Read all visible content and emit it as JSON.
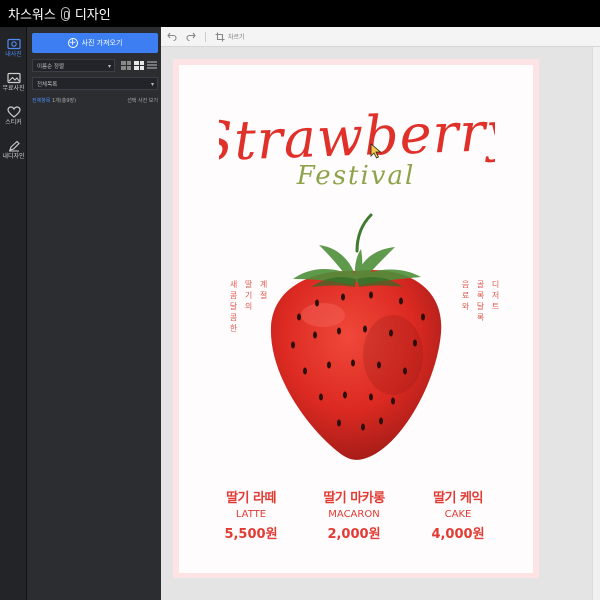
{
  "app": {
    "title_left": "차스워스",
    "title_right": "디자인"
  },
  "rail": [
    {
      "label": "내사진",
      "icon": "photo-icon"
    },
    {
      "label": "무료사진",
      "icon": "free-photo-icon"
    },
    {
      "label": "스티커",
      "icon": "heart-icon"
    },
    {
      "label": "내디자인",
      "icon": "pencil-icon"
    }
  ],
  "panel": {
    "load_button": "사진 가져오기",
    "sort_select": "이름순 정렬",
    "folder_select": "전체목록",
    "info_prefix": "전체항목",
    "info_count": "1개(총9장)",
    "info_action": "선택 사진 보기"
  },
  "toolbar": {
    "crop_label": "자르기"
  },
  "poster": {
    "title": "Strawberry",
    "subtitle": "Festival",
    "left_vertical": [
      "새콤달콤한",
      "딸기의",
      "계절"
    ],
    "right_vertical": [
      "음료와",
      "골록달록",
      "디저트"
    ],
    "menu": [
      {
        "ko": "딸기 라떼",
        "en": "LATTE",
        "price": "5,500원"
      },
      {
        "ko": "딸기 마카롱",
        "en": "MACARON",
        "price": "2,000원"
      },
      {
        "ko": "딸기 케익",
        "en": "CAKE",
        "price": "4,000원"
      }
    ]
  },
  "colors": {
    "accent": "#3d7ff3",
    "poster_red": "#e23b33",
    "leaf": "#8ea34c"
  }
}
